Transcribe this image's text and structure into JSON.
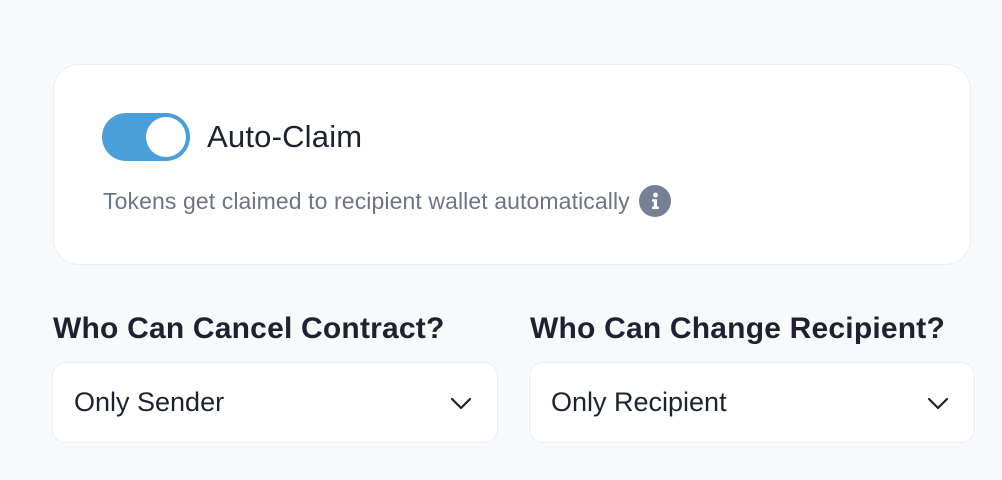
{
  "auto_claim": {
    "label": "Auto-Claim",
    "enabled": true,
    "description": "Tokens get claimed to recipient wallet automatically",
    "info_icon": "info-icon",
    "toggle_color": "#4a9fd8"
  },
  "cancel_contract": {
    "label": "Who Can Cancel Contract?",
    "selected": "Only Sender",
    "icon": "chevron-down-icon"
  },
  "change_recipient": {
    "label": "Who Can Change Recipient?",
    "selected": "Only Recipient",
    "icon": "chevron-down-icon"
  }
}
